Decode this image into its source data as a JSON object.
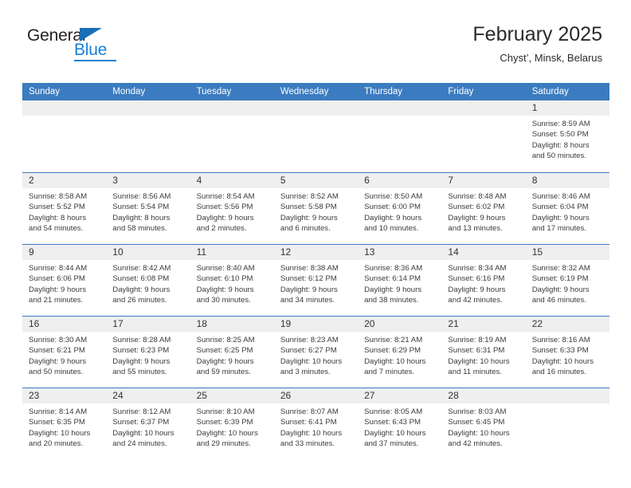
{
  "brand": {
    "name_part1": "General",
    "name_part2": "Blue",
    "triangle_color": "#1a6fb5",
    "blue_color": "#1a7fd4"
  },
  "header": {
    "title": "February 2025",
    "subtitle": "Chyst’, Minsk, Belarus"
  },
  "theme": {
    "header_bar_color": "#3b7cc0",
    "day_band_color": "#efefef",
    "row_separator_color": "#3b7cc0",
    "text_color": "#3b3b3b"
  },
  "weekdays": [
    "Sunday",
    "Monday",
    "Tuesday",
    "Wednesday",
    "Thursday",
    "Friday",
    "Saturday"
  ],
  "weeks": [
    [
      {
        "day": "",
        "info": "",
        "empty": true
      },
      {
        "day": "",
        "info": "",
        "empty": true
      },
      {
        "day": "",
        "info": "",
        "empty": true
      },
      {
        "day": "",
        "info": "",
        "empty": true
      },
      {
        "day": "",
        "info": "",
        "empty": true
      },
      {
        "day": "",
        "info": "",
        "empty": true
      },
      {
        "day": "1",
        "info": "Sunrise: 8:59 AM\nSunset: 5:50 PM\nDaylight: 8 hours\nand 50 minutes.",
        "sunrise": "8:59 AM",
        "sunset": "5:50 PM",
        "daylight": "8 hours and 50 minutes."
      }
    ],
    [
      {
        "day": "2",
        "info": "Sunrise: 8:58 AM\nSunset: 5:52 PM\nDaylight: 8 hours\nand 54 minutes.",
        "sunrise": "8:58 AM",
        "sunset": "5:52 PM",
        "daylight": "8 hours and 54 minutes."
      },
      {
        "day": "3",
        "info": "Sunrise: 8:56 AM\nSunset: 5:54 PM\nDaylight: 8 hours\nand 58 minutes.",
        "sunrise": "8:56 AM",
        "sunset": "5:54 PM",
        "daylight": "8 hours and 58 minutes."
      },
      {
        "day": "4",
        "info": "Sunrise: 8:54 AM\nSunset: 5:56 PM\nDaylight: 9 hours\nand 2 minutes.",
        "sunrise": "8:54 AM",
        "sunset": "5:56 PM",
        "daylight": "9 hours and 2 minutes."
      },
      {
        "day": "5",
        "info": "Sunrise: 8:52 AM\nSunset: 5:58 PM\nDaylight: 9 hours\nand 6 minutes.",
        "sunrise": "8:52 AM",
        "sunset": "5:58 PM",
        "daylight": "9 hours and 6 minutes."
      },
      {
        "day": "6",
        "info": "Sunrise: 8:50 AM\nSunset: 6:00 PM\nDaylight: 9 hours\nand 10 minutes.",
        "sunrise": "8:50 AM",
        "sunset": "6:00 PM",
        "daylight": "9 hours and 10 minutes."
      },
      {
        "day": "7",
        "info": "Sunrise: 8:48 AM\nSunset: 6:02 PM\nDaylight: 9 hours\nand 13 minutes.",
        "sunrise": "8:48 AM",
        "sunset": "6:02 PM",
        "daylight": "9 hours and 13 minutes."
      },
      {
        "day": "8",
        "info": "Sunrise: 8:46 AM\nSunset: 6:04 PM\nDaylight: 9 hours\nand 17 minutes.",
        "sunrise": "8:46 AM",
        "sunset": "6:04 PM",
        "daylight": "9 hours and 17 minutes."
      }
    ],
    [
      {
        "day": "9",
        "info": "Sunrise: 8:44 AM\nSunset: 6:06 PM\nDaylight: 9 hours\nand 21 minutes.",
        "sunrise": "8:44 AM",
        "sunset": "6:06 PM",
        "daylight": "9 hours and 21 minutes."
      },
      {
        "day": "10",
        "info": "Sunrise: 8:42 AM\nSunset: 6:08 PM\nDaylight: 9 hours\nand 26 minutes.",
        "sunrise": "8:42 AM",
        "sunset": "6:08 PM",
        "daylight": "9 hours and 26 minutes."
      },
      {
        "day": "11",
        "info": "Sunrise: 8:40 AM\nSunset: 6:10 PM\nDaylight: 9 hours\nand 30 minutes.",
        "sunrise": "8:40 AM",
        "sunset": "6:10 PM",
        "daylight": "9 hours and 30 minutes."
      },
      {
        "day": "12",
        "info": "Sunrise: 8:38 AM\nSunset: 6:12 PM\nDaylight: 9 hours\nand 34 minutes.",
        "sunrise": "8:38 AM",
        "sunset": "6:12 PM",
        "daylight": "9 hours and 34 minutes."
      },
      {
        "day": "13",
        "info": "Sunrise: 8:36 AM\nSunset: 6:14 PM\nDaylight: 9 hours\nand 38 minutes.",
        "sunrise": "8:36 AM",
        "sunset": "6:14 PM",
        "daylight": "9 hours and 38 minutes."
      },
      {
        "day": "14",
        "info": "Sunrise: 8:34 AM\nSunset: 6:16 PM\nDaylight: 9 hours\nand 42 minutes.",
        "sunrise": "8:34 AM",
        "sunset": "6:16 PM",
        "daylight": "9 hours and 42 minutes."
      },
      {
        "day": "15",
        "info": "Sunrise: 8:32 AM\nSunset: 6:19 PM\nDaylight: 9 hours\nand 46 minutes.",
        "sunrise": "8:32 AM",
        "sunset": "6:19 PM",
        "daylight": "9 hours and 46 minutes."
      }
    ],
    [
      {
        "day": "16",
        "info": "Sunrise: 8:30 AM\nSunset: 6:21 PM\nDaylight: 9 hours\nand 50 minutes.",
        "sunrise": "8:30 AM",
        "sunset": "6:21 PM",
        "daylight": "9 hours and 50 minutes."
      },
      {
        "day": "17",
        "info": "Sunrise: 8:28 AM\nSunset: 6:23 PM\nDaylight: 9 hours\nand 55 minutes.",
        "sunrise": "8:28 AM",
        "sunset": "6:23 PM",
        "daylight": "9 hours and 55 minutes."
      },
      {
        "day": "18",
        "info": "Sunrise: 8:25 AM\nSunset: 6:25 PM\nDaylight: 9 hours\nand 59 minutes.",
        "sunrise": "8:25 AM",
        "sunset": "6:25 PM",
        "daylight": "9 hours and 59 minutes."
      },
      {
        "day": "19",
        "info": "Sunrise: 8:23 AM\nSunset: 6:27 PM\nDaylight: 10 hours\nand 3 minutes.",
        "sunrise": "8:23 AM",
        "sunset": "6:27 PM",
        "daylight": "10 hours and 3 minutes."
      },
      {
        "day": "20",
        "info": "Sunrise: 8:21 AM\nSunset: 6:29 PM\nDaylight: 10 hours\nand 7 minutes.",
        "sunrise": "8:21 AM",
        "sunset": "6:29 PM",
        "daylight": "10 hours and 7 minutes."
      },
      {
        "day": "21",
        "info": "Sunrise: 8:19 AM\nSunset: 6:31 PM\nDaylight: 10 hours\nand 11 minutes.",
        "sunrise": "8:19 AM",
        "sunset": "6:31 PM",
        "daylight": "10 hours and 11 minutes."
      },
      {
        "day": "22",
        "info": "Sunrise: 8:16 AM\nSunset: 6:33 PM\nDaylight: 10 hours\nand 16 minutes.",
        "sunrise": "8:16 AM",
        "sunset": "6:33 PM",
        "daylight": "10 hours and 16 minutes."
      }
    ],
    [
      {
        "day": "23",
        "info": "Sunrise: 8:14 AM\nSunset: 6:35 PM\nDaylight: 10 hours\nand 20 minutes.",
        "sunrise": "8:14 AM",
        "sunset": "6:35 PM",
        "daylight": "10 hours and 20 minutes."
      },
      {
        "day": "24",
        "info": "Sunrise: 8:12 AM\nSunset: 6:37 PM\nDaylight: 10 hours\nand 24 minutes.",
        "sunrise": "8:12 AM",
        "sunset": "6:37 PM",
        "daylight": "10 hours and 24 minutes."
      },
      {
        "day": "25",
        "info": "Sunrise: 8:10 AM\nSunset: 6:39 PM\nDaylight: 10 hours\nand 29 minutes.",
        "sunrise": "8:10 AM",
        "sunset": "6:39 PM",
        "daylight": "10 hours and 29 minutes."
      },
      {
        "day": "26",
        "info": "Sunrise: 8:07 AM\nSunset: 6:41 PM\nDaylight: 10 hours\nand 33 minutes.",
        "sunrise": "8:07 AM",
        "sunset": "6:41 PM",
        "daylight": "10 hours and 33 minutes."
      },
      {
        "day": "27",
        "info": "Sunrise: 8:05 AM\nSunset: 6:43 PM\nDaylight: 10 hours\nand 37 minutes.",
        "sunrise": "8:05 AM",
        "sunset": "6:43 PM",
        "daylight": "10 hours and 37 minutes."
      },
      {
        "day": "28",
        "info": "Sunrise: 8:03 AM\nSunset: 6:45 PM\nDaylight: 10 hours\nand 42 minutes.",
        "sunrise": "8:03 AM",
        "sunset": "6:45 PM",
        "daylight": "10 hours and 42 minutes."
      },
      {
        "day": "",
        "info": "",
        "empty": true
      }
    ]
  ]
}
